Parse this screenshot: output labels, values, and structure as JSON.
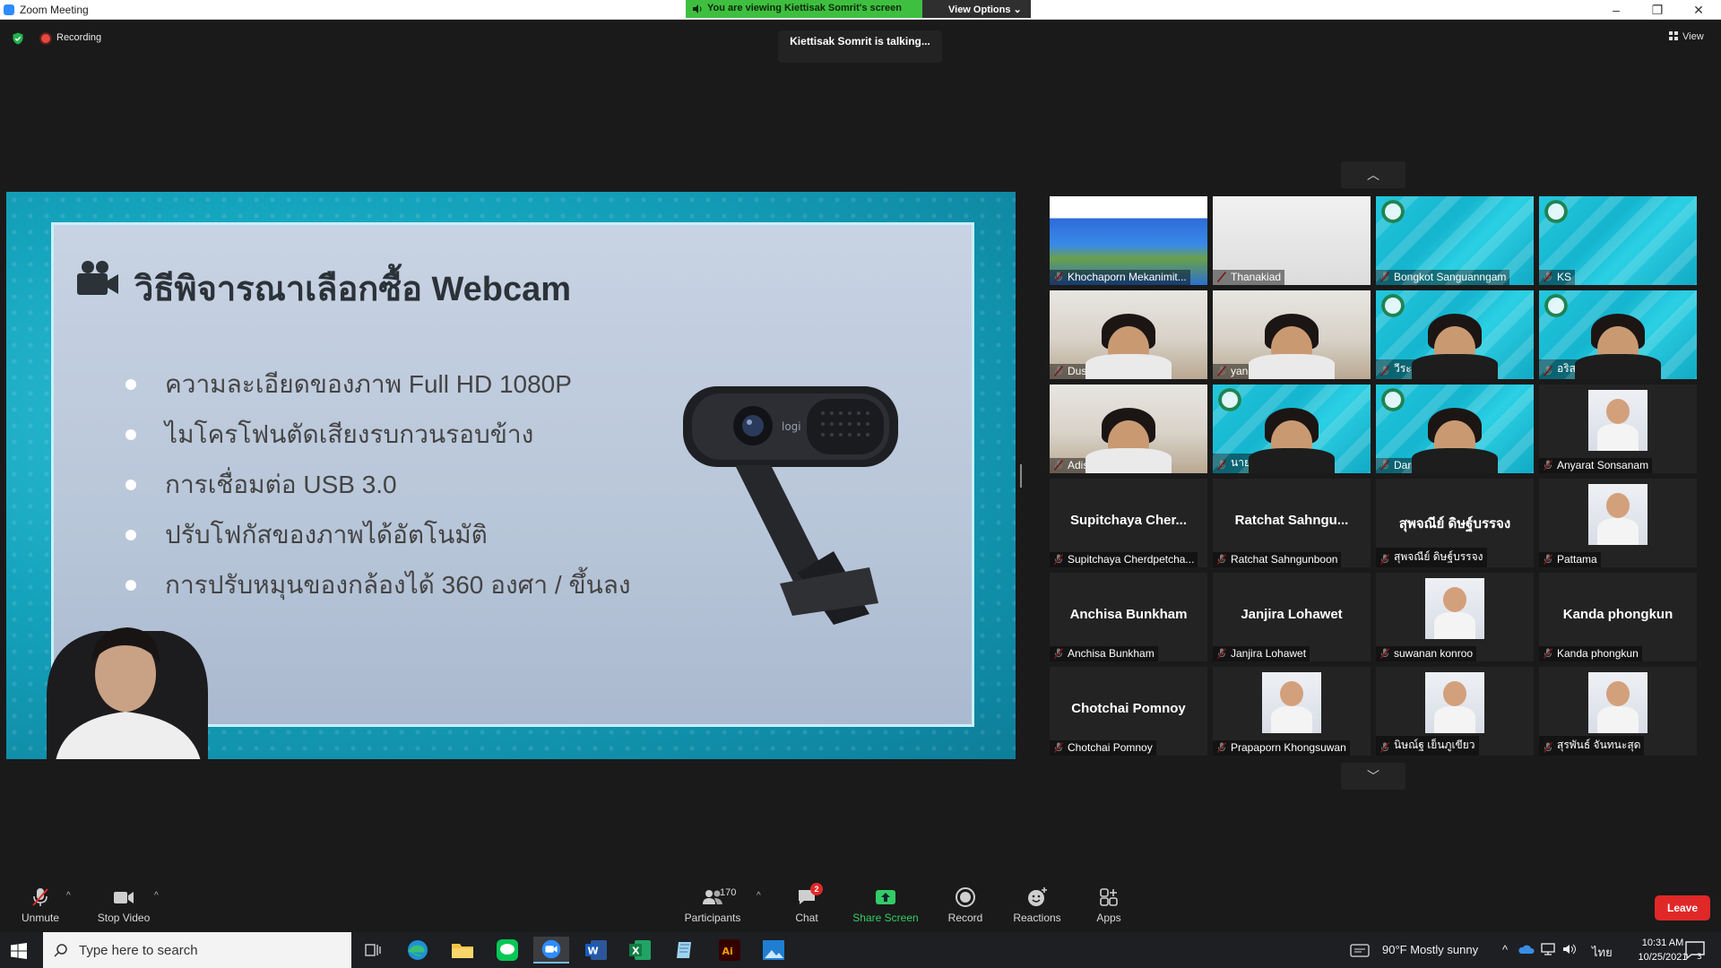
{
  "window": {
    "title": "Zoom Meeting",
    "share_banner": "You are viewing Kiettisak Somrit's screen",
    "view_options": "View Options",
    "controls": [
      "–",
      "❐",
      "✕"
    ]
  },
  "meeting": {
    "recording_label": "Recording",
    "talking": "Kiettisak Somrit is talking...",
    "view_label": "View"
  },
  "slide": {
    "title": "วิธีพิจารณาเลือกซื้อ Webcam",
    "bullets": [
      "ความละเอียดของภาพ Full HD 1080P",
      "ไมโครโฟนตัดเสียงรบกวนรอบข้าง",
      "การเชื่อมต่อ USB 3.0",
      "ปรับโฟกัสของภาพได้อัตโนมัติ",
      "การปรับหมุนของกล้องได้ 360 องศา / ขึ้นลง"
    ],
    "webcam_brand": "logi"
  },
  "gallery": {
    "participants": [
      {
        "name": "Khochaporn Mekanimit...",
        "big": "",
        "style": "poster"
      },
      {
        "name": "Thanakiad",
        "big": "",
        "style": "white"
      },
      {
        "name": "Bongkot Sanguanngam",
        "big": "",
        "style": "cyan"
      },
      {
        "name": "KS",
        "big": "",
        "style": "cyan"
      },
      {
        "name": "Dusiya Puksi",
        "big": "",
        "style": "room"
      },
      {
        "name": "yanee loetsungnoen",
        "big": "",
        "style": "room"
      },
      {
        "name": "วีระ บุญพันธ์",
        "big": "",
        "style": "cyan"
      },
      {
        "name": "อริสรา ศิลาแมง",
        "big": "",
        "style": "cyan"
      },
      {
        "name": "Adisorn Prakobthum",
        "big": "",
        "style": "room"
      },
      {
        "name": "นาย อธิพัฒน์ ตาพันธ์",
        "big": "",
        "style": "cyan"
      },
      {
        "name": "Daraporn",
        "big": "",
        "style": "cyan"
      },
      {
        "name": "Anyarat Sonsanam",
        "big": "",
        "style": "thumb"
      },
      {
        "name": "Supitchaya Cherdpetcha...",
        "big": "Supitchaya  Cher...",
        "style": "dark"
      },
      {
        "name": "Ratchat Sahngunboon",
        "big": "Ratchat  Sahngu...",
        "style": "dark"
      },
      {
        "name": "สุพจณีย์ ดิษฐ์บรรจง",
        "big": "สุพจณีย์ ดิษฐ์บรรจง",
        "style": "dark"
      },
      {
        "name": "Pattama",
        "big": "",
        "style": "thumb"
      },
      {
        "name": "Anchisa Bunkham",
        "big": "Anchisa Bunkham",
        "style": "dark"
      },
      {
        "name": "Janjira Lohawet",
        "big": "Janjira Lohawet",
        "style": "dark"
      },
      {
        "name": "suwanan konroo",
        "big": "",
        "style": "thumb"
      },
      {
        "name": "Kanda phongkun",
        "big": "Kanda phongkun",
        "style": "dark"
      },
      {
        "name": "Chotchai Pomnoy",
        "big": "Chotchai Pomnoy",
        "style": "dark"
      },
      {
        "name": "Prapaporn Khongsuwan",
        "big": "",
        "style": "thumb"
      },
      {
        "name": "นิษณ์ฐ เย็นภูเขียว",
        "big": "",
        "style": "thumb"
      },
      {
        "name": "สุรพันธ์ จันทนะสุด",
        "big": "",
        "style": "thumb"
      }
    ]
  },
  "toolbar": {
    "unmute": "Unmute",
    "stop_video": "Stop Video",
    "participants": "Participants",
    "participant_count": "170",
    "chat": "Chat",
    "chat_badge": "2",
    "share_screen": "Share Screen",
    "record": "Record",
    "reactions": "Reactions",
    "apps": "Apps",
    "leave": "Leave"
  },
  "taskbar": {
    "search_placeholder": "Type here to search",
    "weather": "90°F  Mostly sunny",
    "language": "ไทย",
    "time": "10:31 AM",
    "date": "10/25/2021",
    "notifications": "3"
  },
  "colors": {
    "share_banner": "#3fbf3f",
    "leave": "#e02828",
    "share_screen": "#33cc66",
    "slide_bg": "#15a4bd"
  }
}
